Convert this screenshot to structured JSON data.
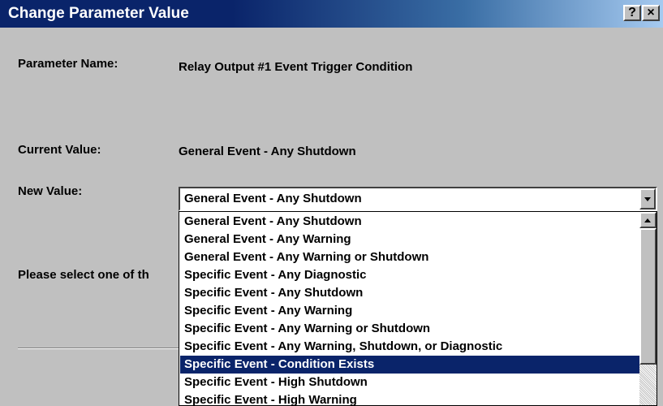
{
  "window": {
    "title": "Change Parameter Value",
    "help_label": "?",
    "close_label": "×"
  },
  "form": {
    "parameter_name_label": "Parameter Name:",
    "parameter_name_value": "Relay Output #1 Event Trigger Condition",
    "current_value_label": "Current Value:",
    "current_value": "General Event - Any Shutdown",
    "new_value_label": "New Value:",
    "new_value_selected": "General Event - Any Shutdown",
    "instruction": "Please select one of th"
  },
  "dropdown": {
    "selected_index": 8,
    "options": [
      "General Event - Any Shutdown",
      "General Event - Any Warning",
      "General Event - Any Warning or Shutdown",
      "Specific Event - Any Diagnostic",
      "Specific Event - Any Shutdown",
      "Specific Event - Any Warning",
      "Specific Event - Any Warning or Shutdown",
      "Specific Event - Any Warning, Shutdown, or Diagnostic",
      "Specific Event - Condition Exists",
      "Specific Event - High Shutdown",
      "Specific Event - High Warning"
    ]
  },
  "icons": {
    "combo_arrow": "chevron-down-icon",
    "scroll_up": "chevron-up-icon"
  },
  "colors": {
    "title_bar": "#0a246a",
    "selection": "#0a246a",
    "face": "#c0c0c0"
  }
}
